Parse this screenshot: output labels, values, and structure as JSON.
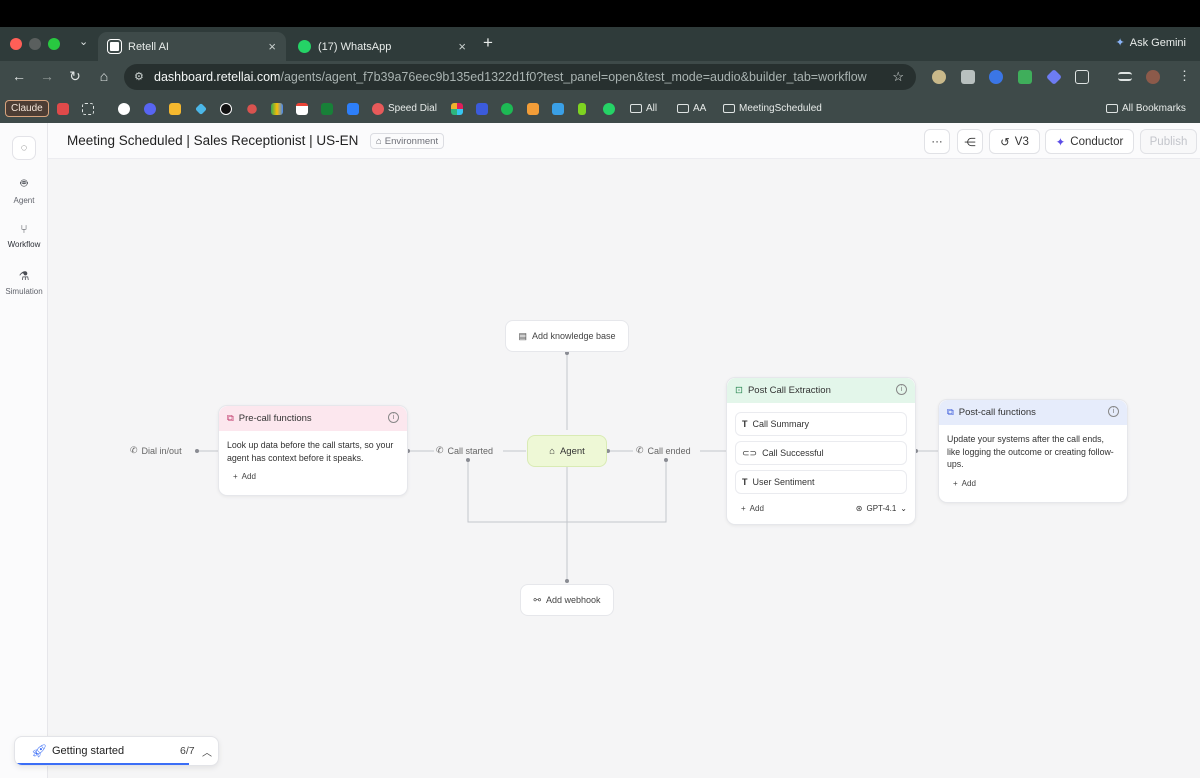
{
  "browser": {
    "tabs": [
      {
        "label": "Retell AI",
        "active": true
      },
      {
        "label": "(17) WhatsApp",
        "active": false
      }
    ],
    "ask_gemini": "Ask Gemini",
    "url_host": "dashboard.retellai.com",
    "url_path": "/agents/agent_f7b39a76eec9b135ed1322d1f0?test_panel=open&test_mode=audio&builder_tab=workflow",
    "bookmarks": {
      "claude": "Claude",
      "speed_dial": "Speed Dial",
      "all": "All",
      "aa": "AA",
      "meeting": "MeetingScheduled",
      "all_bookmarks": "All Bookmarks"
    }
  },
  "sidebar": {
    "items": [
      {
        "label": "Agent",
        "icon": "robot-icon"
      },
      {
        "label": "Workflow",
        "icon": "workflow-icon",
        "active": true
      },
      {
        "label": "Simulation",
        "icon": "flask-icon"
      }
    ]
  },
  "header": {
    "title": "Meeting Scheduled | Sales Receptionist | US-EN",
    "env_tag": "Environment",
    "version": "V3",
    "conductor": "Conductor",
    "publish": "Publish"
  },
  "workflow": {
    "dial": "Dial in/out",
    "precall": {
      "title": "Pre-call functions",
      "desc": "Look up data before the call starts, so your agent has context before it speaks.",
      "add": "Add"
    },
    "call_started": "Call started",
    "agent": "Agent",
    "call_ended": "Call ended",
    "knowledge": "Add knowledge base",
    "webhook": "Add webhook",
    "extraction": {
      "title": "Post Call Extraction",
      "fields": [
        {
          "label": "Call Summary",
          "icon": "text-icon"
        },
        {
          "label": "Call Successful",
          "icon": "toggle-icon"
        },
        {
          "label": "User Sentiment",
          "icon": "text-icon"
        }
      ],
      "add": "Add",
      "model": "GPT-4.1"
    },
    "postcall": {
      "title": "Post-call functions",
      "desc": "Update your systems after the call ends, like logging the outcome or creating follow-ups.",
      "add": "Add"
    }
  },
  "getting_started": {
    "label": "Getting started",
    "progress": "6/7",
    "progress_fraction": 0.857
  },
  "colors": {
    "precall_header": "#fce7ee",
    "extraction_header": "#e3f6ea",
    "postcall_header": "#e6ecfb",
    "agent_node": "#eef8d6",
    "accent_blue": "#3b6ef6"
  }
}
